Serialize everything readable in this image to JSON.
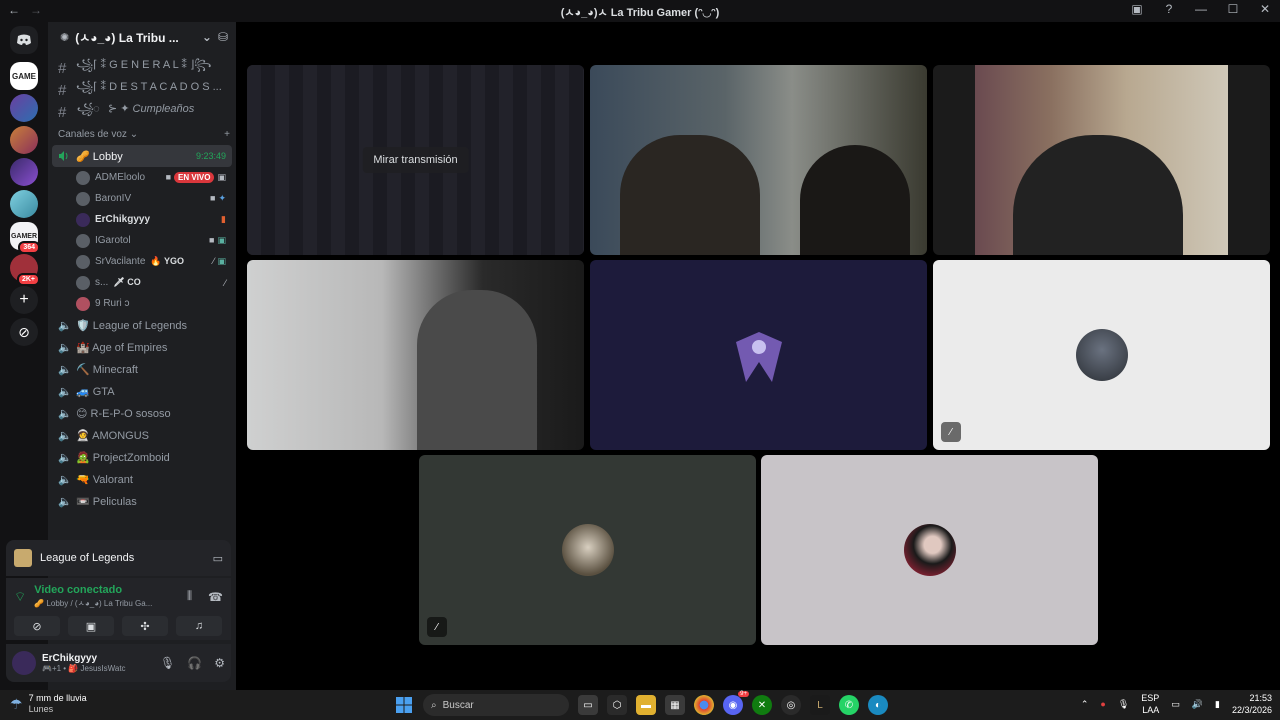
{
  "window": {
    "title": "(ㅅ◕_◕)ㅅ La Tribu Gamer (ᵔ◡ᵔ)"
  },
  "server": {
    "name": "(ㅅ◕_◕) La Tribu ..."
  },
  "text_channels": [
    {
      "label": "꧁⌈ ⁑ G E N E R A L ⁑ ⌋꧂"
    },
    {
      "label": "꧁⌈ ⁑ D E S T A C A D O S ..."
    },
    {
      "label": "꧁◌⃤⊱ ✦ Cumpleaños"
    }
  ],
  "voice_category": {
    "label": "Canales de voz"
  },
  "lobby": {
    "label": "🥜 Lobby",
    "time": "9:23:49"
  },
  "lobby_users": [
    {
      "name": "ADMEloolo",
      "live": "EN VIVO"
    },
    {
      "name": "BaronIV"
    },
    {
      "name": "ErChikgyyy"
    },
    {
      "name": "IGarotol"
    },
    {
      "name": "SrVacilante",
      "tag": "🔥 YGO"
    },
    {
      "name": "s...",
      "tag": "🗡 CO"
    },
    {
      "name": "9 Ruri ɔ"
    }
  ],
  "voice_channels": [
    {
      "label": "🛡️ League of Legends"
    },
    {
      "label": "🏰 Age of Empires"
    },
    {
      "label": "⛏️ Minecraft"
    },
    {
      "label": "🚙 GTA"
    },
    {
      "label": "😊 R-E-P-O sososo"
    },
    {
      "label": "🧑‍🚀 AMONGUS"
    },
    {
      "label": "🧟 ProjectZomboid"
    },
    {
      "label": "🔫 Valorant"
    },
    {
      "label": "📼 Peliculas"
    }
  ],
  "game_activity": {
    "label": "League of Legends"
  },
  "voice_connection": {
    "status": "Video conectado",
    "detail": "🥜 Lobby / (ㅅ◕_◕) La Tribu Ga..."
  },
  "user_panel": {
    "name": "ErChikgyyy",
    "status": "🎮+1 • 🎒 JesusIsWatc"
  },
  "stage": {
    "watch_button": "Mirar transmisión"
  },
  "taskbar": {
    "weather_temp": "7 mm de lluvia",
    "weather_day": "Lunes",
    "search_placeholder": "Buscar",
    "lang": "ESP",
    "lang_sub": "LAA",
    "time": "21:53",
    "date": "22/3/2026",
    "discord_badge": "9+"
  },
  "rail_badges": {
    "a": "364",
    "b": "2K+"
  },
  "colors": {
    "accent_green": "#23a55a",
    "live_red": "#da373c",
    "bg": "#000000",
    "sidebar": "#1e1f22"
  }
}
